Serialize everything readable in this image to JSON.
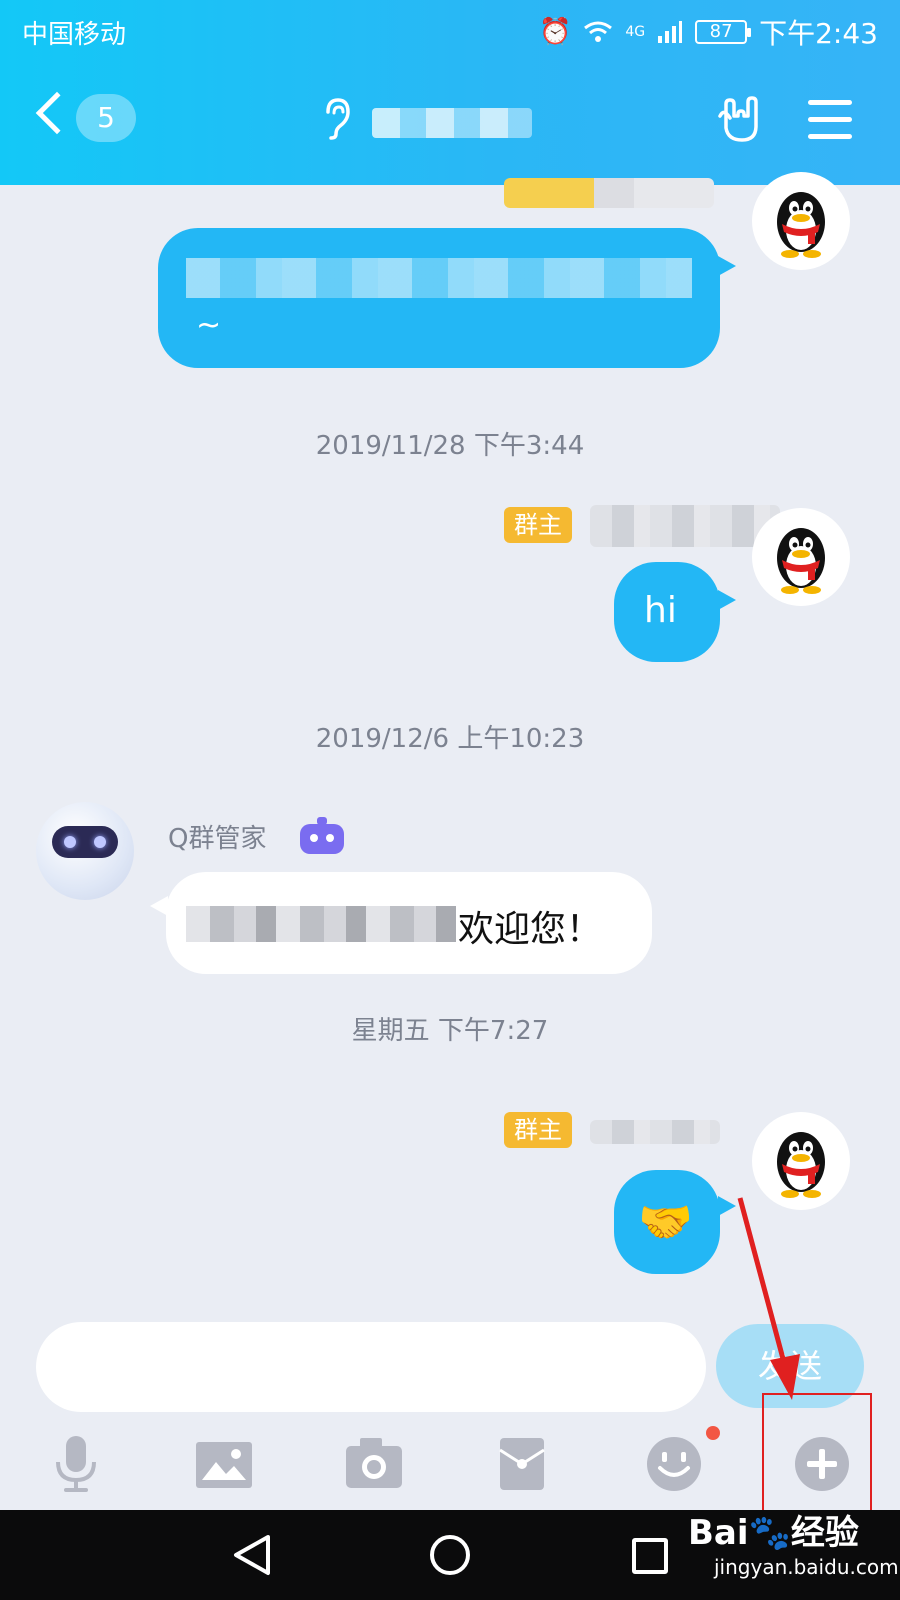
{
  "status_bar": {
    "carrier": "中国移动",
    "network": "4G",
    "battery": "87",
    "time": "下午2:43"
  },
  "header": {
    "back_count": "5"
  },
  "messages": [
    {
      "type": "outgoing",
      "text_tail": "~"
    },
    {
      "type": "timestamp",
      "text": "2019/11/28 下午3:44"
    },
    {
      "type": "outgoing",
      "role_badge": "群主",
      "text": "hi"
    },
    {
      "type": "timestamp",
      "text": "2019/12/6 上午10:23"
    },
    {
      "type": "incoming",
      "sender": "Q群管家",
      "text_tail": "欢迎您！"
    },
    {
      "type": "timestamp",
      "text": "星期五 下午7:27"
    },
    {
      "type": "outgoing",
      "role_badge": "群主",
      "emoji": "🤝"
    }
  ],
  "input": {
    "send_label": "发送"
  },
  "toolbar": {
    "items": [
      "microphone-icon",
      "picture-icon",
      "camera-icon",
      "red-packet-icon",
      "emoji-icon",
      "plus-icon"
    ]
  },
  "watermark": {
    "main": "Bai🐾经验",
    "sub": "jingyan.baidu.com"
  },
  "colors": {
    "header": "#23b7f5",
    "bubble": "#23b7f5",
    "badge": "#f5b931",
    "highlight": "#e02020"
  }
}
